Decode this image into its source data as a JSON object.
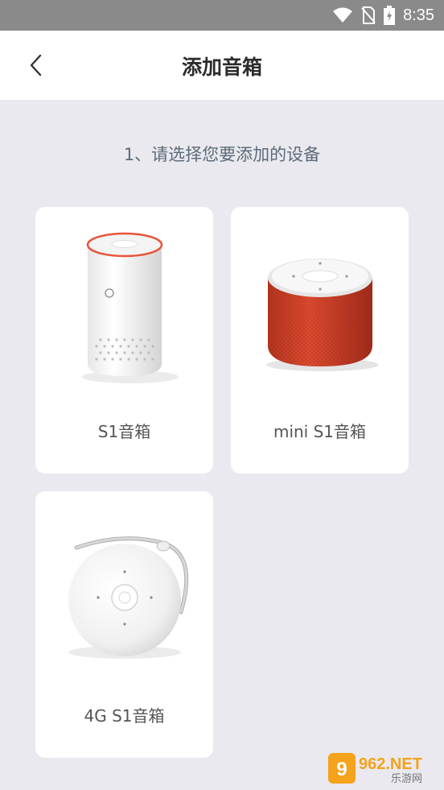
{
  "status_bar": {
    "time": "8:35",
    "icons": [
      "wifi-icon",
      "no-sim-icon",
      "battery-charging-icon"
    ]
  },
  "header": {
    "title": "添加音箱",
    "back_icon": "chevron-left-icon"
  },
  "instruction": "1、请选择您要添加的设备",
  "devices": [
    {
      "label": "S1音箱",
      "image": "white-cylinder-speaker"
    },
    {
      "label": "mini S1音箱",
      "image": "red-fabric-speaker"
    },
    {
      "label": "4G S1音箱",
      "image": "white-round-portable-speaker"
    }
  ],
  "watermark": {
    "text_top": "962.NET",
    "text_bottom": "乐游网"
  },
  "colors": {
    "background": "#e9e9ef",
    "status_bar": "#8a8a8a",
    "card": "#ffffff",
    "speaker_accent_red": "#d9442c"
  }
}
